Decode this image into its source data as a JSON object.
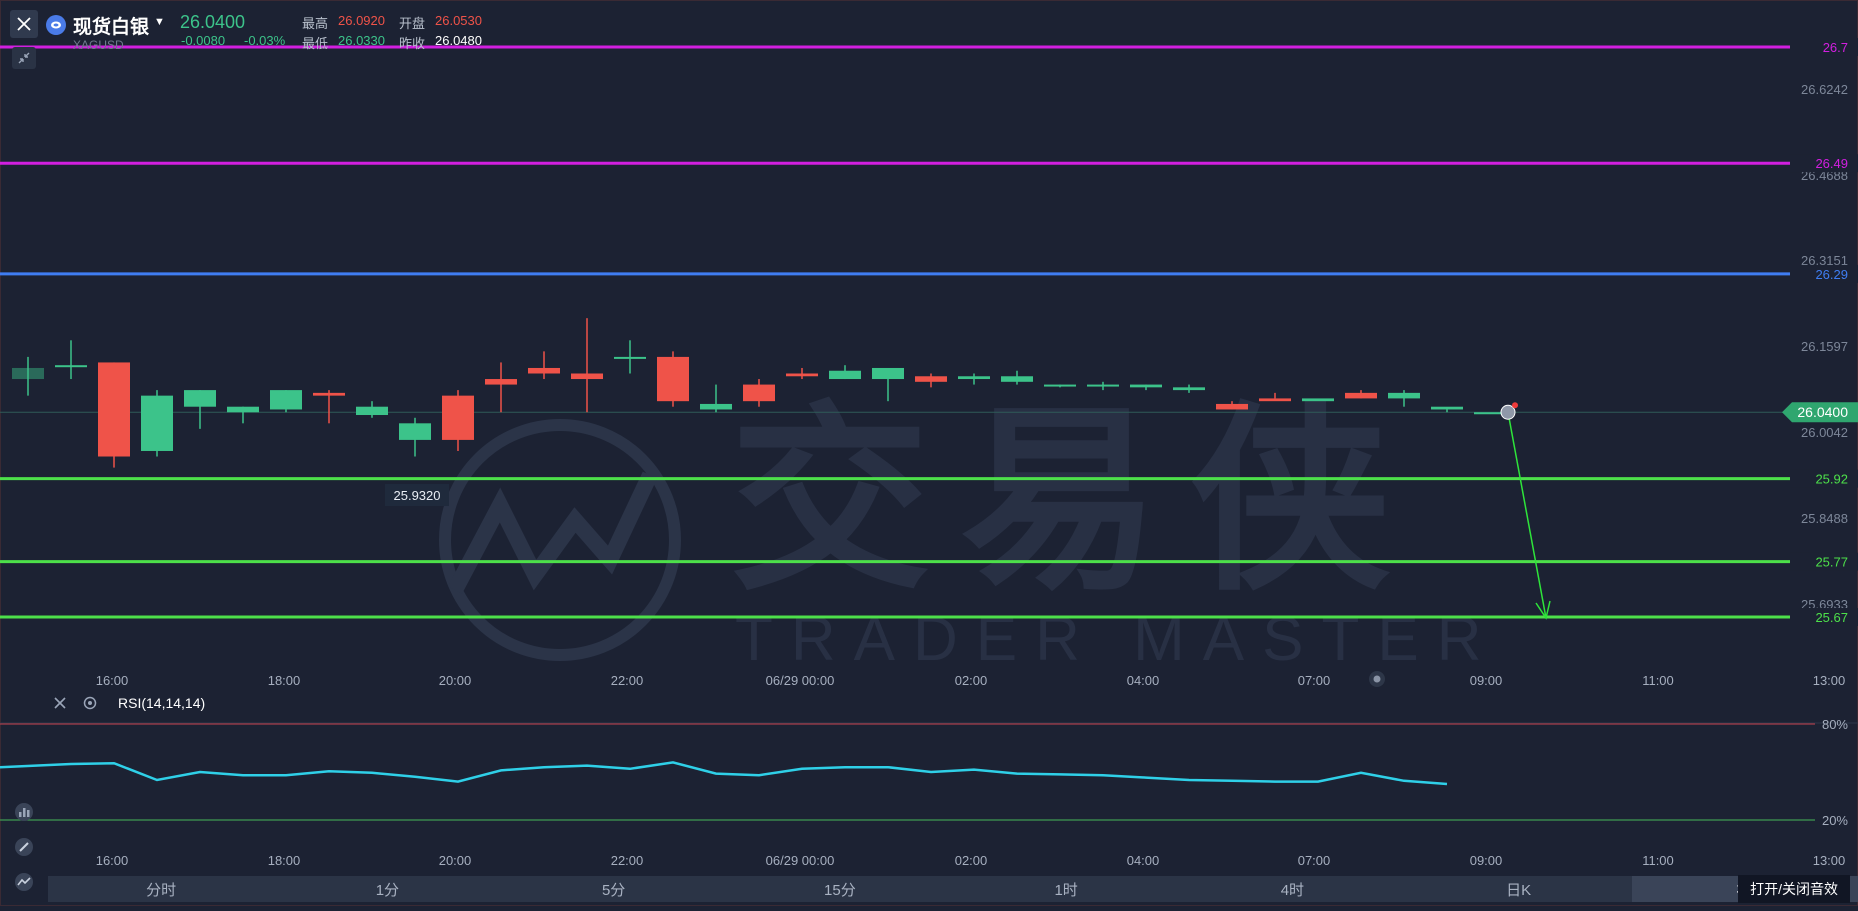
{
  "header": {
    "symbol_name": "现货白银",
    "symbol_code": "XAGUSD",
    "last_price": "26.0400",
    "change": "-0.0080",
    "change_pct": "-0.03%",
    "high_label": "最高",
    "high_value": "26.0920",
    "open_label": "开盘",
    "open_value": "26.0530",
    "low_label": "最低",
    "low_value": "26.0330",
    "prev_close_label": "昨收",
    "prev_close_value": "26.0480"
  },
  "price_axis": {
    "ticks": [
      "26.6242",
      "26.4688",
      "26.3151",
      "26.1597",
      "26.0042",
      "25.8488",
      "25.6933"
    ],
    "current_price_tag": "26.0400"
  },
  "levels": [
    {
      "value": "26.7",
      "color": "#d21fe0"
    },
    {
      "value": "26.49",
      "color": "#d21fe0"
    },
    {
      "value": "26.29",
      "color": "#3f7df2"
    },
    {
      "value": "25.92",
      "color": "#4de04a"
    },
    {
      "value": "25.77",
      "color": "#4de04a"
    },
    {
      "value": "25.67",
      "color": "#4de04a"
    }
  ],
  "low_marker": "25.9320",
  "time_axis": [
    "16:00",
    "18:00",
    "20:00",
    "22:00",
    "06/29 00:00",
    "02:00",
    "04:00",
    "07:00",
    "09:00",
    "11:00",
    "13:00"
  ],
  "rsi": {
    "label": "RSI(14,14,14)",
    "upper_band": "80%",
    "lower_band": "20%"
  },
  "periods": [
    "分时",
    "1分",
    "5分",
    "15分",
    "1时",
    "4时",
    "日K",
    "30"
  ],
  "active_period": "30",
  "sound_toggle": "打开/关闭音效",
  "watermark": {
    "cn": "交易侠",
    "en": "TRADER MASTER"
  },
  "colors": {
    "background": "#1c2233",
    "up": "#3cc38a",
    "down": "#ef5349",
    "rsi_line": "#2fd0e8"
  },
  "chart_data": {
    "type": "candlestick",
    "x": [
      "15:00",
      "16:00",
      "16:30",
      "17:00",
      "17:30",
      "18:00",
      "18:30",
      "19:00",
      "19:30",
      "20:00",
      "20:30",
      "21:00",
      "21:30",
      "22:00",
      "22:30",
      "23:00",
      "23:30",
      "00:00",
      "00:30",
      "01:00",
      "01:30",
      "02:00",
      "02:30",
      "03:00",
      "03:30",
      "04:00",
      "04:30",
      "05:00",
      "05:30",
      "06:00",
      "06:30",
      "07:00",
      "07:30",
      "08:00",
      "08:30"
    ],
    "ohlc": [
      [
        26.1,
        26.14,
        26.07,
        26.12
      ],
      [
        26.125,
        26.17,
        26.1,
        26.125
      ],
      [
        26.13,
        26.13,
        25.94,
        25.96
      ],
      [
        25.97,
        26.08,
        25.96,
        26.07
      ],
      [
        26.05,
        26.08,
        26.01,
        26.08
      ],
      [
        26.04,
        26.05,
        26.02,
        26.05
      ],
      [
        26.045,
        26.08,
        26.04,
        26.08
      ],
      [
        26.075,
        26.08,
        26.02,
        26.07
      ],
      [
        26.035,
        26.06,
        26.03,
        26.05
      ],
      [
        25.99,
        26.03,
        25.96,
        26.02
      ],
      [
        26.07,
        26.08,
        25.97,
        25.99
      ],
      [
        26.1,
        26.13,
        26.04,
        26.09
      ],
      [
        26.12,
        26.15,
        26.1,
        26.11
      ],
      [
        26.11,
        26.21,
        26.04,
        26.1
      ],
      [
        26.14,
        26.17,
        26.11,
        26.14
      ],
      [
        26.14,
        26.15,
        26.05,
        26.06
      ],
      [
        26.045,
        26.09,
        26.04,
        26.055
      ],
      [
        26.09,
        26.1,
        26.05,
        26.06
      ],
      [
        26.11,
        26.12,
        26.1,
        26.105
      ],
      [
        26.1,
        26.125,
        26.1,
        26.115
      ],
      [
        26.1,
        26.11,
        26.06,
        26.12
      ],
      [
        26.105,
        26.11,
        26.085,
        26.095
      ],
      [
        26.1,
        26.11,
        26.09,
        26.105
      ],
      [
        26.095,
        26.115,
        26.09,
        26.105
      ],
      [
        26.09,
        26.09,
        26.085,
        26.09
      ],
      [
        26.09,
        26.095,
        26.08,
        26.09
      ],
      [
        26.085,
        26.09,
        26.08,
        26.09
      ],
      [
        26.08,
        26.09,
        26.075,
        26.085
      ],
      [
        26.055,
        26.06,
        26.045,
        26.045
      ],
      [
        26.065,
        26.075,
        26.065,
        26.06
      ],
      [
        26.06,
        26.06,
        26.06,
        26.065
      ],
      [
        26.075,
        26.08,
        26.065,
        26.065
      ],
      [
        26.065,
        26.08,
        26.05,
        26.075
      ],
      [
        26.045,
        26.045,
        26.04,
        26.05
      ],
      [
        26.04,
        26.04,
        26.04,
        26.04
      ]
    ],
    "levels": [
      26.7,
      26.49,
      26.29,
      25.92,
      25.77,
      25.67
    ],
    "current_price": 26.04,
    "rsi_values": [
      53,
      55,
      55.5,
      45,
      50,
      48,
      48,
      50.5,
      49.5,
      47,
      44,
      51,
      53,
      54,
      52,
      56,
      49,
      48,
      52,
      53,
      53,
      50,
      51.5,
      49,
      48.5,
      48,
      46.5,
      45,
      44.5,
      44,
      44,
      49.5,
      44.5,
      42.5
    ]
  }
}
